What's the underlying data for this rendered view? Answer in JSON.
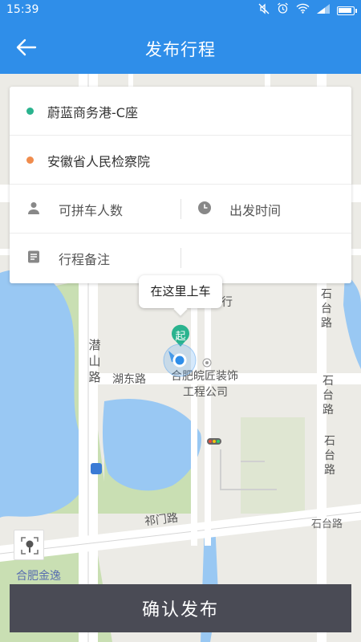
{
  "status_bar": {
    "time": "15:39",
    "icons": [
      "mute-icon",
      "alarm-icon",
      "wifi-icon",
      "signal-icon",
      "battery-icon"
    ]
  },
  "header": {
    "title": "发布行程",
    "back_icon": "arrow-left-icon"
  },
  "form": {
    "origin": "蔚蓝商务港-C座",
    "destination": "安徽省人民检察院",
    "seats_placeholder": "可拼车人数",
    "time_placeholder": "出发时间",
    "note_placeholder": "行程备注"
  },
  "map": {
    "pickup_tooltip": "在这里上车",
    "start_marker": "起",
    "labels": {
      "qianshan_road_1": "潜",
      "qianshan_road_2": "山",
      "qianshan_road_3": "路",
      "hudong_road": "湖东路",
      "company_1": "合肥皖匠装饰",
      "company_2": "工程公司",
      "shitai_road_a1": "石",
      "shitai_road_a2": "台",
      "shitai_road_a3": "路",
      "shitai_road_b1": "石",
      "shitai_road_b2": "台",
      "shitai_road_b3": "路",
      "shitai_road_c1": "石",
      "shitai_road_c2": "台",
      "shitai_road_c3": "路",
      "shitai_road_d": "石台路",
      "qimen_road": "祁门路",
      "jinyi": "合肥金逸",
      "hang_fragment": "行"
    }
  },
  "actions": {
    "confirm_label": "确认发布"
  },
  "colors": {
    "primary": "#2f8ee9",
    "origin_dot": "#2ab38e",
    "destination_dot": "#f08c4d",
    "confirm_bg": "#4a4b55"
  }
}
